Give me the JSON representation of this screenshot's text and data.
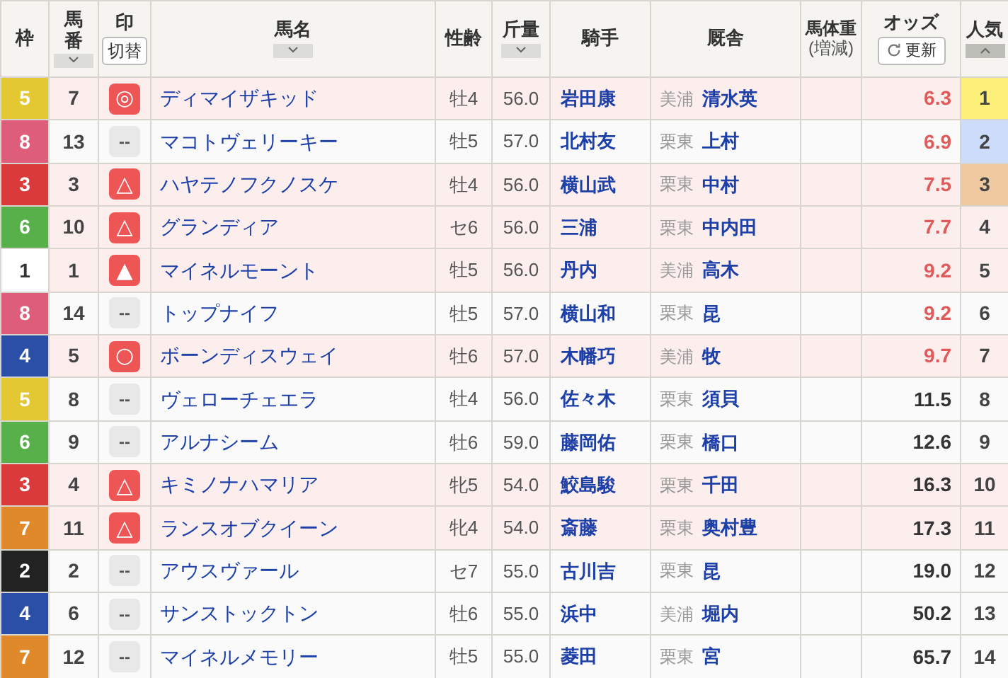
{
  "columns": [
    {
      "label": "枠"
    },
    {
      "label": "馬番",
      "sortable": true,
      "selected": false
    },
    {
      "label": "印",
      "button": "切替"
    },
    {
      "label": "馬名",
      "sortable": true,
      "selected": false
    },
    {
      "label": "性齢"
    },
    {
      "label": "斤量",
      "sortable": true,
      "selected": false
    },
    {
      "label": "騎手"
    },
    {
      "label": "厩舎"
    },
    {
      "label": "馬体重",
      "sub": "(増減)"
    },
    {
      "label": "オッズ",
      "button": "更新"
    },
    {
      "label": "人気",
      "sortable": true,
      "selected": true
    }
  ],
  "rows": [
    {
      "frame": "5",
      "color": "#e3c733",
      "number": "7",
      "mark": {
        "kind": "pick",
        "text": "◎"
      },
      "name": "ディマイザキッド",
      "sex_age": "牡4",
      "weight": "56.0",
      "jockey": "岩田康",
      "region": "美浦",
      "trainer": "清水英",
      "odds": "6.3",
      "odds_hot": true,
      "pop": {
        "text": "1",
        "color": "#fdf07a"
      }
    },
    {
      "frame": "8",
      "color": "#de5d7b",
      "number": "13",
      "mark": {
        "kind": "none",
        "text": "--"
      },
      "name": "マコトヴェリーキー",
      "sex_age": "牡5",
      "weight": "57.0",
      "jockey": "北村友",
      "region": "栗東",
      "trainer": "上村",
      "odds": "6.9",
      "odds_hot": true,
      "pop": {
        "text": "2",
        "color": "#cddcfb"
      }
    },
    {
      "frame": "3",
      "color": "#db3a3a",
      "number": "3",
      "mark": {
        "kind": "pick",
        "text": "△"
      },
      "name": "ハヤテノフクノスケ",
      "sex_age": "牡4",
      "weight": "56.0",
      "jockey": "横山武",
      "region": "栗東",
      "trainer": "中村",
      "odds": "7.5",
      "odds_hot": true,
      "pop": {
        "text": "3",
        "color": "#efc9a0"
      }
    },
    {
      "frame": "6",
      "color": "#58b04a",
      "number": "10",
      "mark": {
        "kind": "pick",
        "text": "△"
      },
      "name": "グランディア",
      "sex_age": "セ6",
      "weight": "56.0",
      "jockey": "三浦",
      "region": "栗東",
      "trainer": "中内田",
      "odds": "7.7",
      "odds_hot": true,
      "pop": {
        "text": "4"
      }
    },
    {
      "frame": "1",
      "color": "#ffffff",
      "number": "1",
      "mark": {
        "kind": "pick",
        "text": "▲"
      },
      "name": "マイネルモーント",
      "sex_age": "牡5",
      "weight": "56.0",
      "jockey": "丹内",
      "region": "美浦",
      "trainer": "高木",
      "odds": "9.2",
      "odds_hot": true,
      "pop": {
        "text": "5"
      }
    },
    {
      "frame": "8",
      "color": "#de5d7b",
      "number": "14",
      "mark": {
        "kind": "none",
        "text": "--"
      },
      "name": "トップナイフ",
      "sex_age": "牡5",
      "weight": "57.0",
      "jockey": "横山和",
      "region": "栗東",
      "trainer": "昆",
      "odds": "9.2",
      "odds_hot": true,
      "pop": {
        "text": "6"
      }
    },
    {
      "frame": "4",
      "color": "#2b4ea6",
      "number": "5",
      "mark": {
        "kind": "pick",
        "text": "○"
      },
      "name": "ボーンディスウェイ",
      "sex_age": "牡6",
      "weight": "57.0",
      "jockey": "木幡巧",
      "region": "美浦",
      "trainer": "牧",
      "odds": "9.7",
      "odds_hot": true,
      "pop": {
        "text": "7"
      }
    },
    {
      "frame": "5",
      "color": "#e3c733",
      "number": "8",
      "mark": {
        "kind": "none",
        "text": "--"
      },
      "name": "ヴェローチェエラ",
      "sex_age": "牡4",
      "weight": "56.0",
      "jockey": "佐々木",
      "region": "栗東",
      "trainer": "須貝",
      "odds": "11.5",
      "odds_hot": false,
      "pop": {
        "text": "8"
      }
    },
    {
      "frame": "6",
      "color": "#58b04a",
      "number": "9",
      "mark": {
        "kind": "none",
        "text": "--"
      },
      "name": "アルナシーム",
      "sex_age": "牡6",
      "weight": "59.0",
      "jockey": "藤岡佑",
      "region": "栗東",
      "trainer": "橋口",
      "odds": "12.6",
      "odds_hot": false,
      "pop": {
        "text": "9"
      }
    },
    {
      "frame": "3",
      "color": "#db3a3a",
      "number": "4",
      "mark": {
        "kind": "pick",
        "text": "△"
      },
      "name": "キミノナハマリア",
      "sex_age": "牝5",
      "weight": "54.0",
      "jockey": "鮫島駿",
      "region": "栗東",
      "trainer": "千田",
      "odds": "16.3",
      "odds_hot": false,
      "pop": {
        "text": "10"
      }
    },
    {
      "frame": "7",
      "color": "#e0892a",
      "number": "11",
      "mark": {
        "kind": "pick",
        "text": "△"
      },
      "name": "ランスオブクイーン",
      "sex_age": "牝4",
      "weight": "54.0",
      "jockey": "斎藤",
      "region": "栗東",
      "trainer": "奥村豊",
      "odds": "17.3",
      "odds_hot": false,
      "pop": {
        "text": "11"
      }
    },
    {
      "frame": "2",
      "color": "#222222",
      "number": "2",
      "mark": {
        "kind": "none",
        "text": "--"
      },
      "name": "アウスヴァール",
      "sex_age": "セ7",
      "weight": "55.0",
      "jockey": "古川吉",
      "region": "栗東",
      "trainer": "昆",
      "odds": "19.0",
      "odds_hot": false,
      "pop": {
        "text": "12"
      }
    },
    {
      "frame": "4",
      "color": "#2b4ea6",
      "number": "6",
      "mark": {
        "kind": "none",
        "text": "--"
      },
      "name": "サンストックトン",
      "sex_age": "牡6",
      "weight": "55.0",
      "jockey": "浜中",
      "region": "美浦",
      "trainer": "堀内",
      "odds": "50.2",
      "odds_hot": false,
      "pop": {
        "text": "13"
      }
    },
    {
      "frame": "7",
      "color": "#e0892a",
      "number": "12",
      "mark": {
        "kind": "none",
        "text": "--"
      },
      "name": "マイネルメモリー",
      "sex_age": "牡5",
      "weight": "55.0",
      "jockey": "菱田",
      "region": "栗東",
      "trainer": "宮",
      "odds": "65.7",
      "odds_hot": false,
      "pop": {
        "text": "14"
      }
    }
  ]
}
